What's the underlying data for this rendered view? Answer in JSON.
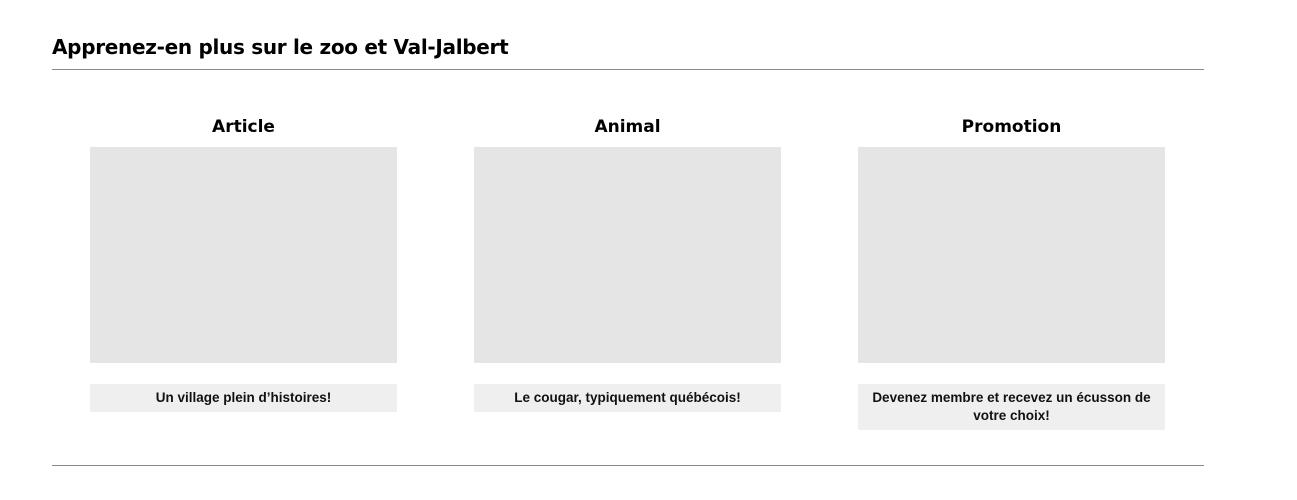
{
  "section": {
    "title": "Apprenez-en plus sur le zoo et Val-Jalbert"
  },
  "cards": [
    {
      "heading": "Article",
      "button_label": "Un village plein d’histoires!"
    },
    {
      "heading": "Animal",
      "button_label": "Le cougar, typiquement québécois!"
    },
    {
      "heading": "Promotion",
      "button_label": "Devenez membre et recevez un écusson de votre choix!"
    }
  ],
  "colors": {
    "image_placeholder": "#e5e5e5",
    "button_background": "#efefef",
    "divider": "#8a8a8a"
  }
}
